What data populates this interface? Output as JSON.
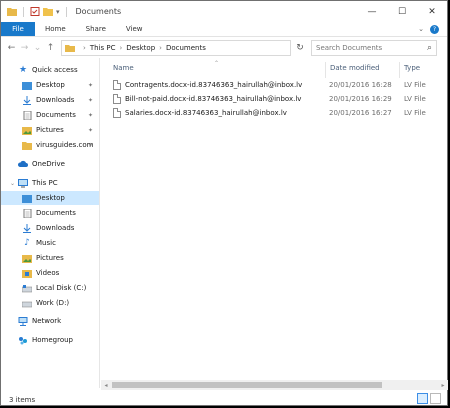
{
  "window": {
    "title": "Documents",
    "controls": {
      "minimize": "—",
      "maximize": "☐",
      "close": "✕"
    }
  },
  "ribbon": {
    "tabs": [
      "File",
      "Home",
      "Share",
      "View"
    ],
    "expand_glyph": "⌄",
    "help_glyph": "?"
  },
  "nav": {
    "back": "←",
    "forward": "→",
    "recent": "⌄",
    "up": "↑",
    "breadcrumb": [
      "This PC",
      "Desktop",
      "Documents"
    ],
    "refresh": "↻",
    "search_placeholder": "Search Documents",
    "search_icon": "⌕"
  },
  "sidebar": {
    "quick_access": {
      "label": "Quick access",
      "items": [
        "Desktop",
        "Downloads",
        "Documents",
        "Pictures",
        "virusguides.com"
      ]
    },
    "onedrive": "OneDrive",
    "this_pc": {
      "label": "This PC",
      "items": [
        "Desktop",
        "Documents",
        "Downloads",
        "Music",
        "Pictures",
        "Videos",
        "Local Disk (C:)",
        "Work (D:)"
      ],
      "selected": "Desktop"
    },
    "network": "Network",
    "homegroup": "Homegroup"
  },
  "file_list": {
    "columns": [
      "Name",
      "Date modified",
      "Type"
    ],
    "rows": [
      {
        "name": "Contragents.docx-id.83746363_hairullah@inbox.lv",
        "date": "20/01/2016 16:28",
        "type": "LV File"
      },
      {
        "name": "Bill-not-paid.docx-id.83746363_hairullah@inbox.lv",
        "date": "20/01/2016 16:29",
        "type": "LV File"
      },
      {
        "name": "Salaries.docx-id.83746363_hairullah@inbox.lv",
        "date": "20/01/2016 16:27",
        "type": "LV File"
      }
    ]
  },
  "status": {
    "item_count": "3 items"
  },
  "colors": {
    "accent": "#1979ca",
    "selection": "#cce8ff",
    "folder": "#e8b94a"
  }
}
